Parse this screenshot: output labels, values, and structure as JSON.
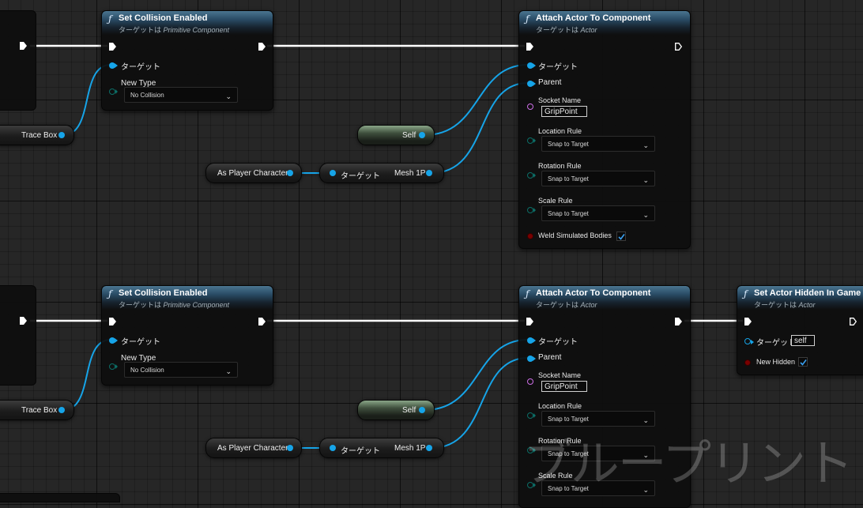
{
  "graph": {
    "rows": [
      {
        "set_collision": {
          "title": "Set Collision Enabled",
          "subtitle_prefix": "ターゲットは ",
          "subtitle_class": "Primitive Component",
          "target_label": "ターゲット",
          "new_type_label": "New Type",
          "new_type_value": "No Collision"
        },
        "trace_box": "Trace Box",
        "self_label": "Self",
        "as_player": "As Player Character",
        "mesh_node": {
          "target_label": "ターゲット",
          "output_label": "Mesh 1P"
        },
        "attach": {
          "title": "Attach Actor To Component",
          "subtitle_prefix": "ターゲットは ",
          "subtitle_class": "Actor",
          "target_label": "ターゲット",
          "parent_label": "Parent",
          "socket_label": "Socket Name",
          "socket_value": "GripPoint",
          "location_label": "Location Rule",
          "location_value": "Snap to Target",
          "rotation_label": "Rotation Rule",
          "rotation_value": "Snap to Target",
          "scale_label": "Scale Rule",
          "scale_value": "Snap to Target",
          "weld_label": "Weld Simulated Bodies"
        }
      },
      {
        "set_collision": {
          "title": "Set Collision Enabled",
          "subtitle_prefix": "ターゲットは ",
          "subtitle_class": "Primitive Component",
          "target_label": "ターゲット",
          "new_type_label": "New Type",
          "new_type_value": "No Collision"
        },
        "trace_box": "Trace Box",
        "self_label": "Self",
        "as_player": "As Player Character",
        "mesh_node": {
          "target_label": "ターゲット",
          "output_label": "Mesh 1P"
        },
        "attach": {
          "title": "Attach Actor To Component",
          "subtitle_prefix": "ターゲットは ",
          "subtitle_class": "Actor",
          "target_label": "ターゲット",
          "parent_label": "Parent",
          "socket_label": "Socket Name",
          "socket_value": "GripPoint",
          "location_label": "Location Rule",
          "location_value": "Snap to Target",
          "rotation_label": "Rotation Rule",
          "rotation_value": "Snap to Target",
          "scale_label": "Scale Rule",
          "scale_value": "Snap to Target"
        }
      }
    ],
    "hidden_node": {
      "title": "Set Actor Hidden In Game",
      "subtitle_prefix": "ターゲットは ",
      "subtitle_class": "Actor",
      "target_label": "ターゲット",
      "target_value": "self",
      "new_hidden_label": "New Hidden"
    }
  },
  "watermark": "ブループリント",
  "icons": {
    "function": "function-icon",
    "exec_pin": "exec-pin-icon",
    "checkmark": "checkmark-icon",
    "chevron": "chevron-down-icon"
  },
  "colors": {
    "header": "#2a4c66",
    "object_pin": "#16a4e8",
    "enum_pin": "#0c6e67",
    "name_pin": "#cc6ee6",
    "bool_pin": "#7a0000",
    "exec_wire": "#ffffff"
  }
}
